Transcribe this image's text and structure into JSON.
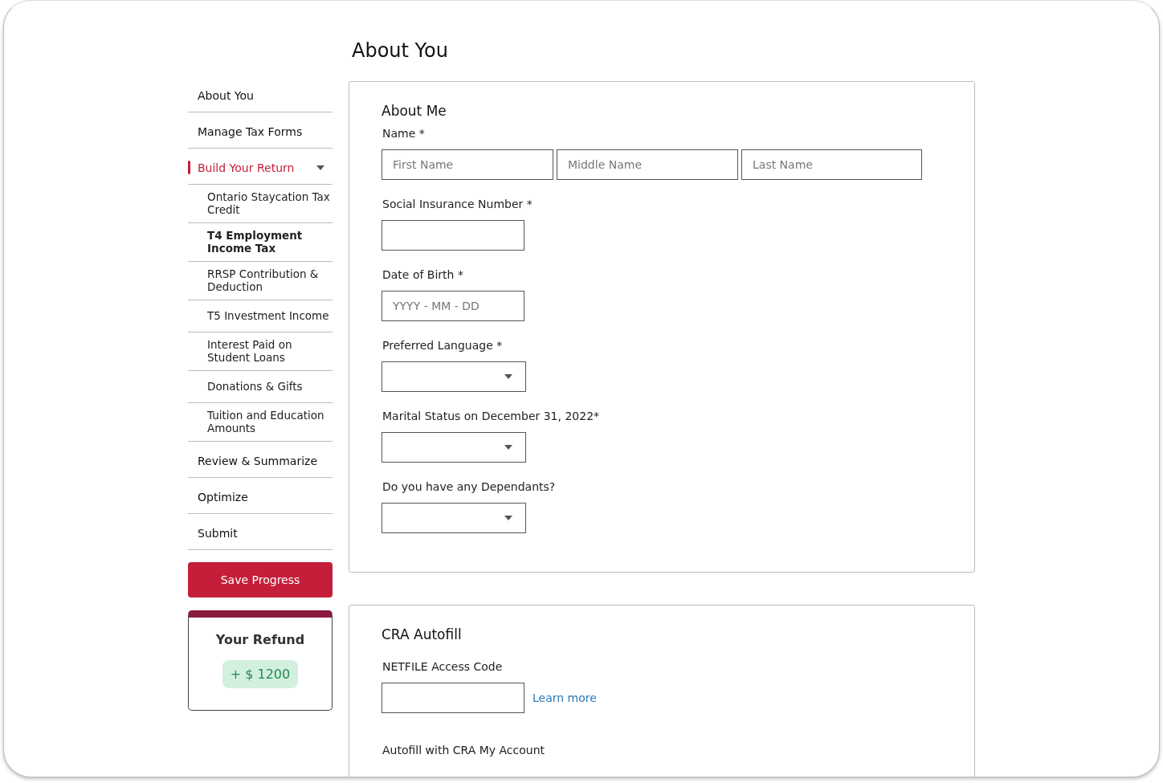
{
  "page": {
    "title": "About You"
  },
  "sidebar": {
    "items": [
      {
        "label": "About You",
        "selected": false
      },
      {
        "label": "Manage Tax Forms",
        "selected": false
      },
      {
        "label": "Build Your Return",
        "selected": true,
        "expanded": true,
        "children": [
          {
            "label": "Ontario Staycation Tax Credit",
            "selected": false
          },
          {
            "label": "T4 Employment Income Tax",
            "selected": true
          },
          {
            "label": "RRSP Contribution & Deduction",
            "selected": false
          },
          {
            "label": "T5 Investment Income",
            "selected": false
          },
          {
            "label": "Interest Paid on Student Loans",
            "selected": false
          },
          {
            "label": "Donations & Gifts",
            "selected": false
          },
          {
            "label": "Tuition and Education Amounts",
            "selected": false
          }
        ]
      },
      {
        "label": "Review & Summarize",
        "selected": false
      },
      {
        "label": "Optimize",
        "selected": false
      },
      {
        "label": "Submit",
        "selected": false
      }
    ],
    "save_button": "Save Progress",
    "refund": {
      "title": "Your Refund",
      "amount": "+ $ 1200"
    }
  },
  "cards": [
    {
      "title": "About Me",
      "fields": [
        {
          "kind": "name",
          "label": "Name *",
          "inputs": [
            {
              "placeholder": "First Name"
            },
            {
              "placeholder": "Middle Name"
            },
            {
              "placeholder": "Last Name"
            }
          ]
        },
        {
          "kind": "text",
          "label": "Social Insurance Number *"
        },
        {
          "kind": "text",
          "label": "Date of Birth *",
          "placeholder": "YYYY - MM - DD"
        },
        {
          "kind": "select",
          "label": "Preferred Language *"
        },
        {
          "kind": "select",
          "label": "Marital Status on December 31, 2022*"
        },
        {
          "kind": "select",
          "label": "Do you have any Dependants?"
        }
      ]
    },
    {
      "title": "CRA Autofill",
      "fields": [
        {
          "kind": "text",
          "label": "NETFILE Access Code",
          "link": "Learn more"
        },
        {
          "kind": "heading",
          "label": "Autofill with CRA My Account"
        }
      ]
    }
  ]
}
